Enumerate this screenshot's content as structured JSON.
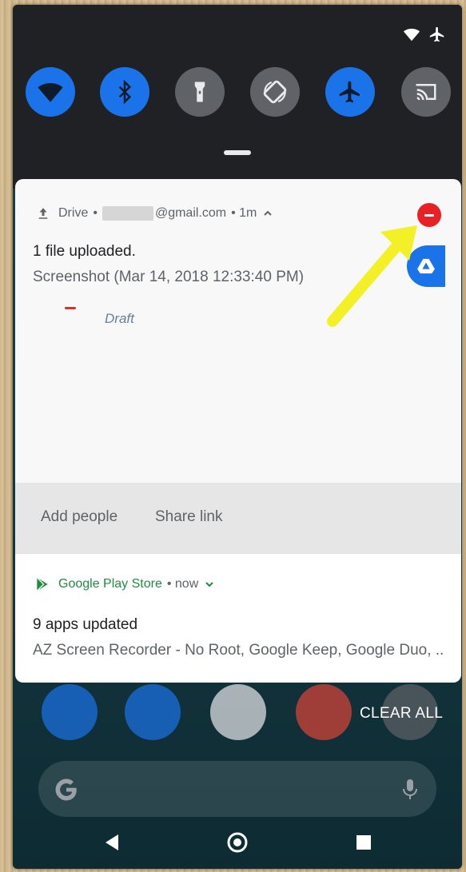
{
  "quick_settings": {
    "tiles": [
      {
        "name": "wifi",
        "state": "on"
      },
      {
        "name": "bluetooth",
        "state": "on"
      },
      {
        "name": "flashlight",
        "state": "off"
      },
      {
        "name": "auto-rotate",
        "state": "off"
      },
      {
        "name": "airplane-mode",
        "state": "on"
      },
      {
        "name": "cast",
        "state": "off"
      }
    ]
  },
  "drive_notification": {
    "app": "Drive",
    "separator": "•",
    "account": "@gmail.com",
    "time": "• 1m",
    "title": "1 file uploaded.",
    "text": "Screenshot (Mar 14, 2018 12:33:40 PM)",
    "preview_label": "Draft",
    "actions": [
      "Add people",
      "Share link"
    ]
  },
  "play_notification": {
    "app": "Google Play Store",
    "time": "• now",
    "title": "9 apps updated",
    "text": "AZ Screen Recorder - No Root, Google Keep, Google Duo, .."
  },
  "home": {
    "clear_all": "CLEAR ALL"
  },
  "colors": {
    "accent": "#1a73e8",
    "remove": "#e82126",
    "arrow": "#f3f028"
  }
}
